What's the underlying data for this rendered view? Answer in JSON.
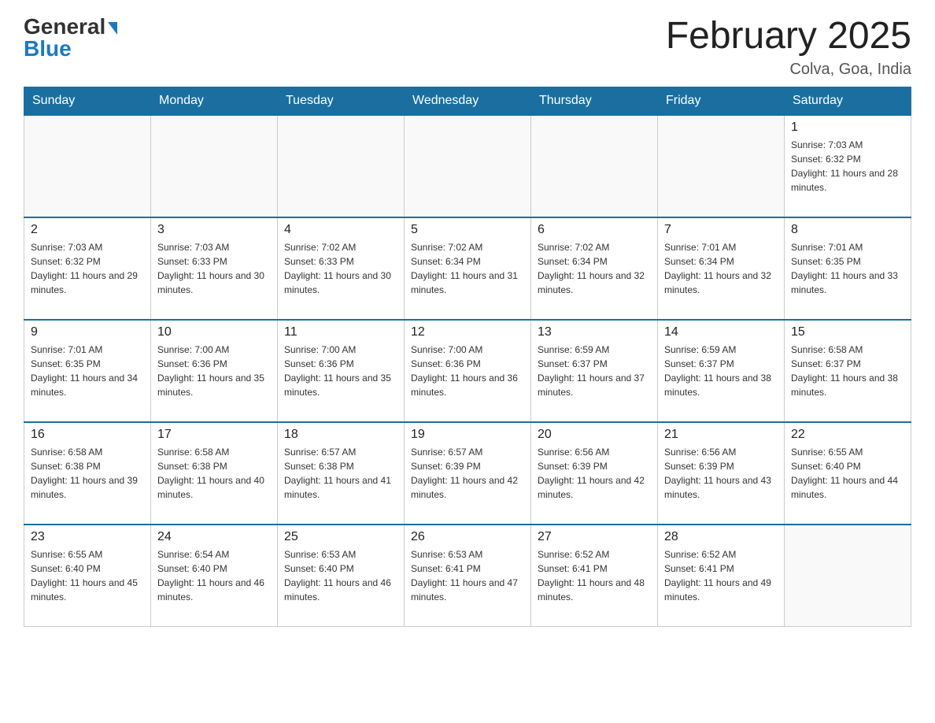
{
  "header": {
    "logo_general": "General",
    "logo_blue": "Blue",
    "month_year": "February 2025",
    "location": "Colva, Goa, India"
  },
  "days_of_week": [
    "Sunday",
    "Monday",
    "Tuesday",
    "Wednesday",
    "Thursday",
    "Friday",
    "Saturday"
  ],
  "weeks": [
    [
      {
        "day": "",
        "info": ""
      },
      {
        "day": "",
        "info": ""
      },
      {
        "day": "",
        "info": ""
      },
      {
        "day": "",
        "info": ""
      },
      {
        "day": "",
        "info": ""
      },
      {
        "day": "",
        "info": ""
      },
      {
        "day": "1",
        "info": "Sunrise: 7:03 AM\nSunset: 6:32 PM\nDaylight: 11 hours and 28 minutes."
      }
    ],
    [
      {
        "day": "2",
        "info": "Sunrise: 7:03 AM\nSunset: 6:32 PM\nDaylight: 11 hours and 29 minutes."
      },
      {
        "day": "3",
        "info": "Sunrise: 7:03 AM\nSunset: 6:33 PM\nDaylight: 11 hours and 30 minutes."
      },
      {
        "day": "4",
        "info": "Sunrise: 7:02 AM\nSunset: 6:33 PM\nDaylight: 11 hours and 30 minutes."
      },
      {
        "day": "5",
        "info": "Sunrise: 7:02 AM\nSunset: 6:34 PM\nDaylight: 11 hours and 31 minutes."
      },
      {
        "day": "6",
        "info": "Sunrise: 7:02 AM\nSunset: 6:34 PM\nDaylight: 11 hours and 32 minutes."
      },
      {
        "day": "7",
        "info": "Sunrise: 7:01 AM\nSunset: 6:34 PM\nDaylight: 11 hours and 32 minutes."
      },
      {
        "day": "8",
        "info": "Sunrise: 7:01 AM\nSunset: 6:35 PM\nDaylight: 11 hours and 33 minutes."
      }
    ],
    [
      {
        "day": "9",
        "info": "Sunrise: 7:01 AM\nSunset: 6:35 PM\nDaylight: 11 hours and 34 minutes."
      },
      {
        "day": "10",
        "info": "Sunrise: 7:00 AM\nSunset: 6:36 PM\nDaylight: 11 hours and 35 minutes."
      },
      {
        "day": "11",
        "info": "Sunrise: 7:00 AM\nSunset: 6:36 PM\nDaylight: 11 hours and 35 minutes."
      },
      {
        "day": "12",
        "info": "Sunrise: 7:00 AM\nSunset: 6:36 PM\nDaylight: 11 hours and 36 minutes."
      },
      {
        "day": "13",
        "info": "Sunrise: 6:59 AM\nSunset: 6:37 PM\nDaylight: 11 hours and 37 minutes."
      },
      {
        "day": "14",
        "info": "Sunrise: 6:59 AM\nSunset: 6:37 PM\nDaylight: 11 hours and 38 minutes."
      },
      {
        "day": "15",
        "info": "Sunrise: 6:58 AM\nSunset: 6:37 PM\nDaylight: 11 hours and 38 minutes."
      }
    ],
    [
      {
        "day": "16",
        "info": "Sunrise: 6:58 AM\nSunset: 6:38 PM\nDaylight: 11 hours and 39 minutes."
      },
      {
        "day": "17",
        "info": "Sunrise: 6:58 AM\nSunset: 6:38 PM\nDaylight: 11 hours and 40 minutes."
      },
      {
        "day": "18",
        "info": "Sunrise: 6:57 AM\nSunset: 6:38 PM\nDaylight: 11 hours and 41 minutes."
      },
      {
        "day": "19",
        "info": "Sunrise: 6:57 AM\nSunset: 6:39 PM\nDaylight: 11 hours and 42 minutes."
      },
      {
        "day": "20",
        "info": "Sunrise: 6:56 AM\nSunset: 6:39 PM\nDaylight: 11 hours and 42 minutes."
      },
      {
        "day": "21",
        "info": "Sunrise: 6:56 AM\nSunset: 6:39 PM\nDaylight: 11 hours and 43 minutes."
      },
      {
        "day": "22",
        "info": "Sunrise: 6:55 AM\nSunset: 6:40 PM\nDaylight: 11 hours and 44 minutes."
      }
    ],
    [
      {
        "day": "23",
        "info": "Sunrise: 6:55 AM\nSunset: 6:40 PM\nDaylight: 11 hours and 45 minutes."
      },
      {
        "day": "24",
        "info": "Sunrise: 6:54 AM\nSunset: 6:40 PM\nDaylight: 11 hours and 46 minutes."
      },
      {
        "day": "25",
        "info": "Sunrise: 6:53 AM\nSunset: 6:40 PM\nDaylight: 11 hours and 46 minutes."
      },
      {
        "day": "26",
        "info": "Sunrise: 6:53 AM\nSunset: 6:41 PM\nDaylight: 11 hours and 47 minutes."
      },
      {
        "day": "27",
        "info": "Sunrise: 6:52 AM\nSunset: 6:41 PM\nDaylight: 11 hours and 48 minutes."
      },
      {
        "day": "28",
        "info": "Sunrise: 6:52 AM\nSunset: 6:41 PM\nDaylight: 11 hours and 49 minutes."
      },
      {
        "day": "",
        "info": ""
      }
    ]
  ]
}
